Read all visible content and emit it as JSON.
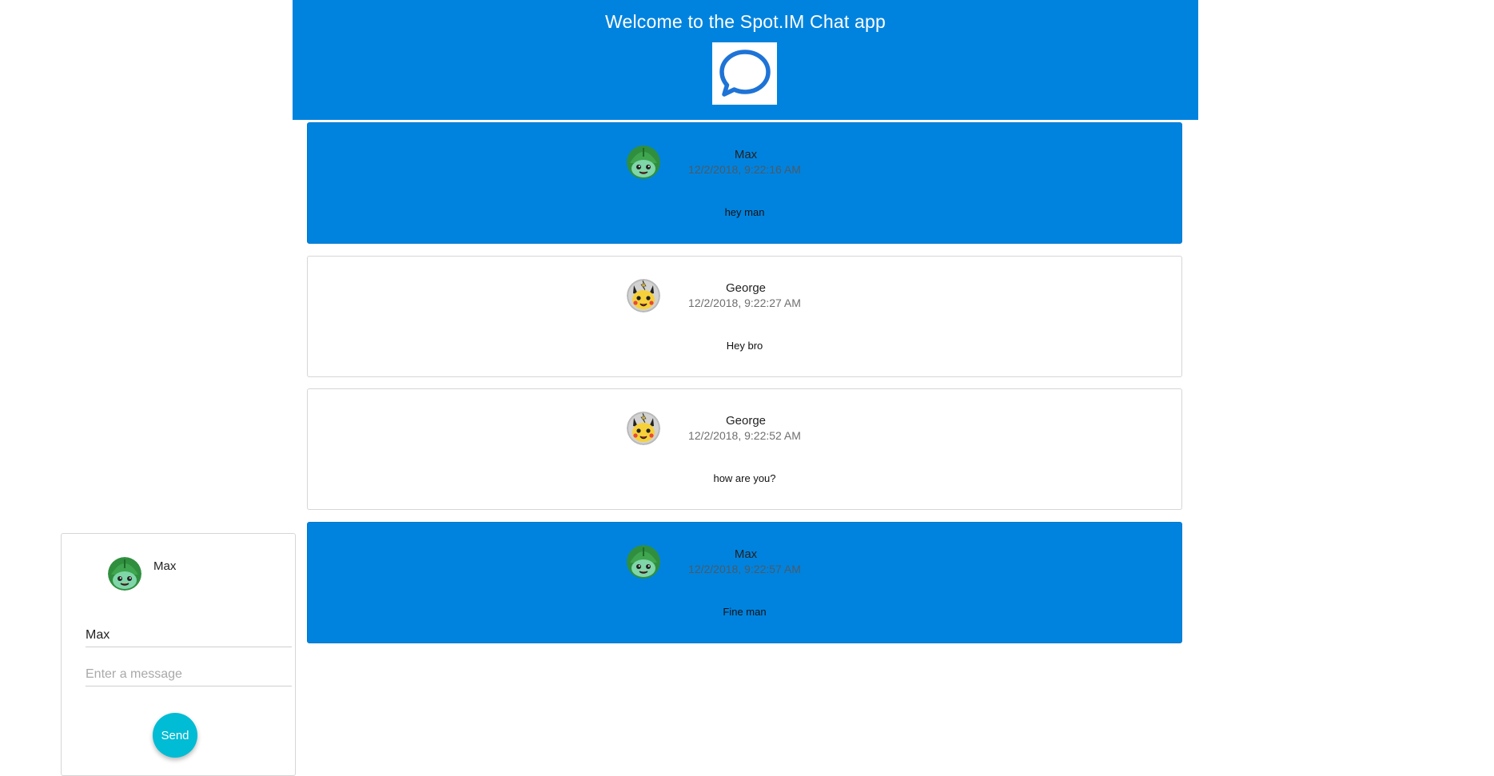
{
  "header": {
    "title": "Welcome to the Spot.IM Chat app",
    "logo_icon": "chat-bubble-icon"
  },
  "colors": {
    "header_bg": "#0083de",
    "own_message_bg": "#0083de",
    "other_message_bg": "#ffffff",
    "send_button": "#00bcd4"
  },
  "messages": [
    {
      "author": "Max",
      "timestamp": "12/2/2018, 9:22:16 AM",
      "text": "hey man",
      "style": "blue",
      "avatar_icon": "bulbasaur-avatar-icon"
    },
    {
      "author": "George",
      "timestamp": "12/2/2018, 9:22:27 AM",
      "text": "Hey bro",
      "style": "white",
      "avatar_icon": "pikachu-avatar-icon"
    },
    {
      "author": "George",
      "timestamp": "12/2/2018, 9:22:52 AM",
      "text": "how are you?",
      "style": "white",
      "avatar_icon": "pikachu-avatar-icon"
    },
    {
      "author": "Max",
      "timestamp": "12/2/2018, 9:22:57 AM",
      "text": "Fine man",
      "style": "blue",
      "avatar_icon": "bulbasaur-avatar-icon"
    }
  ],
  "compose": {
    "username": "Max",
    "avatar_icon": "bulbasaur-avatar-icon",
    "name_value": "Max",
    "message_placeholder": "Enter a message",
    "send_label": "Send"
  }
}
